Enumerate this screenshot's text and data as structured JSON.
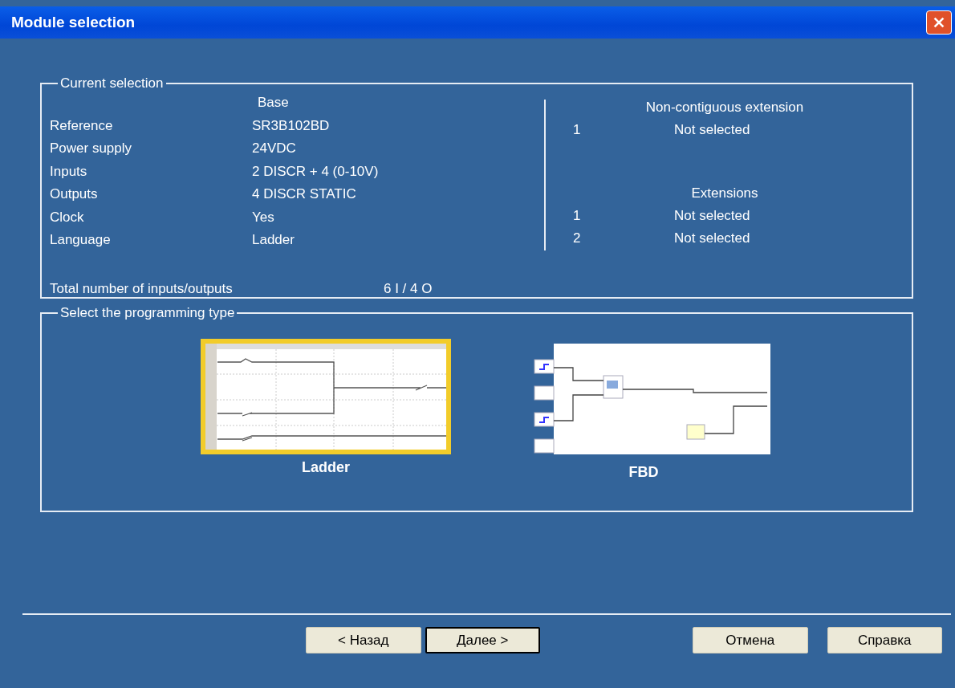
{
  "window": {
    "title": "Module selection"
  },
  "current_selection": {
    "legend": "Current selection",
    "base_heading": "Base",
    "fields": [
      {
        "label": "Reference",
        "value": "SR3B102BD"
      },
      {
        "label": "Power supply",
        "value": "24VDC"
      },
      {
        "label": "Inputs",
        "value": "2 DISCR + 4 (0-10V)"
      },
      {
        "label": "Outputs",
        "value": "4 DISCR STATIC"
      },
      {
        "label": "Clock",
        "value": "Yes"
      },
      {
        "label": "Language",
        "value": "Ladder"
      }
    ],
    "total": {
      "label": "Total number of inputs/outputs",
      "value": "6 I / 4 O"
    },
    "non_contiguous_extension": {
      "heading": "Non-contiguous extension",
      "slots": [
        {
          "number": "1",
          "value": "Not selected"
        }
      ]
    },
    "extensions": {
      "heading": "Extensions",
      "slots": [
        {
          "number": "1",
          "value": "Not selected"
        },
        {
          "number": "2",
          "value": "Not selected"
        }
      ]
    }
  },
  "programming_type": {
    "legend": "Select the programming type",
    "options": [
      {
        "kind": "ladder",
        "label": "Ladder",
        "selected": true
      },
      {
        "kind": "fbd",
        "label": "FBD",
        "selected": false
      }
    ]
  },
  "buttons": [
    {
      "label": "< Назад",
      "default": false
    },
    {
      "label": "Далее >",
      "default": true
    },
    {
      "label": "Отмена",
      "default": false
    },
    {
      "label": "Справка",
      "default": false
    }
  ]
}
